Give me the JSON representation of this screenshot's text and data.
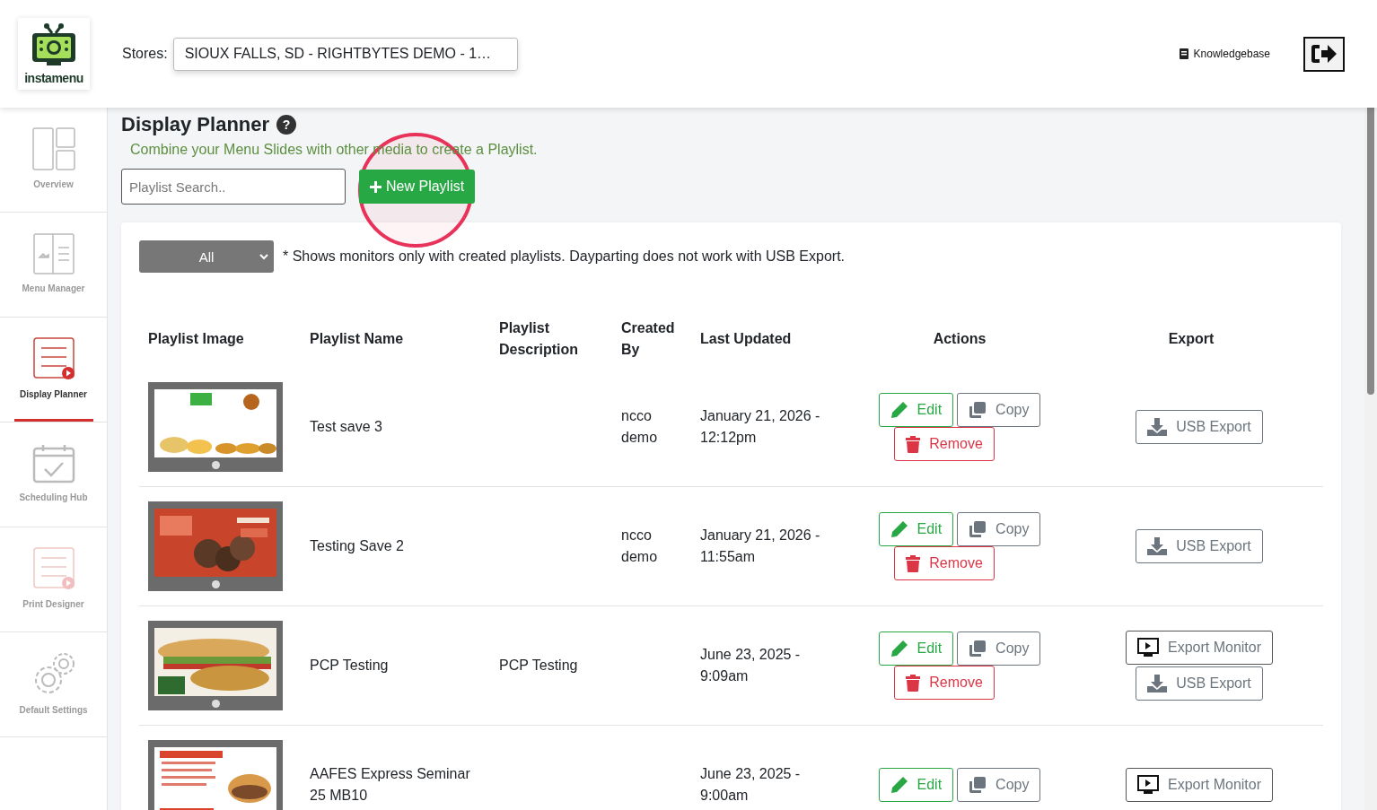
{
  "header": {
    "logo_text": "instamenu",
    "stores_label": "Stores:",
    "stores_value": "SIOUX FALLS, SD - RIGHTBYTES DEMO - 1…",
    "knowledgebase": "Knowledgebase"
  },
  "sidebar": {
    "items": [
      {
        "label": "Overview",
        "kind": "overview",
        "selected": false
      },
      {
        "label": "Menu Manager",
        "kind": "menu",
        "selected": false
      },
      {
        "label": "Display Planner",
        "kind": "planner",
        "selected": true
      },
      {
        "label": "Scheduling Hub",
        "kind": "calendar",
        "selected": false
      },
      {
        "label": "Print Designer",
        "kind": "print",
        "selected": false
      },
      {
        "label": "Default Settings",
        "kind": "settings",
        "selected": false
      }
    ]
  },
  "page": {
    "title": "Display Planner",
    "help": "?",
    "subtitle": "Combine your Menu Slides with other media to create a Playlist.",
    "search_placeholder": "Playlist Search..",
    "new_button": "New Playlist"
  },
  "filter": {
    "value": "All",
    "note": "* Shows monitors only with created playlists. Dayparting does not work with USB Export."
  },
  "table": {
    "columns": [
      "Playlist Image",
      "Playlist Name",
      "Playlist Description",
      "Created By",
      "Last Updated",
      "Actions",
      "Export"
    ],
    "rows": [
      {
        "image": {
          "kind": "picture"
        },
        "name": "Test save 3",
        "description": "",
        "created_by": "ncco demo",
        "updated": "January 21, 2026 - 12:12pm",
        "actions": [
          "Edit",
          "Copy",
          "Remove"
        ],
        "export": [
          {
            "kind": "usb",
            "label": "USB Export"
          }
        ]
      },
      {
        "image": {
          "kind": "picture"
        },
        "name": "Testing Save 2",
        "description": "",
        "created_by": "ncco demo",
        "updated": "January 21, 2026 - 11:55am",
        "actions": [
          "Edit",
          "Copy",
          "Remove"
        ],
        "export": [
          {
            "kind": "usb",
            "label": "USB Export"
          }
        ]
      },
      {
        "image": {
          "kind": "picture"
        },
        "name": "PCP Testing",
        "description": "PCP Testing",
        "created_by": "",
        "updated": "June 23, 2025 - 9:09am",
        "actions": [
          "Edit",
          "Copy",
          "Remove"
        ],
        "export": [
          {
            "kind": "monitor",
            "label": "Export Monitor"
          },
          {
            "kind": "usb",
            "label": "USB Export"
          }
        ]
      },
      {
        "image": {
          "kind": "picture"
        },
        "name": "AAFES Express Seminar 25 MB10",
        "description": "",
        "created_by": "",
        "updated": "June 23, 2025 - 9:00am",
        "actions": [
          "Edit",
          "Copy"
        ],
        "export": [
          {
            "kind": "monitor",
            "label": "Export Monitor"
          }
        ]
      }
    ]
  }
}
